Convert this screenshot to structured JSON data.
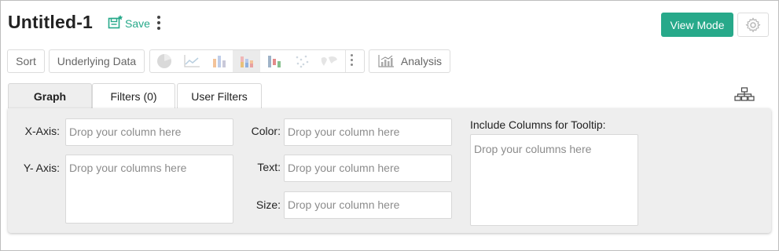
{
  "header": {
    "title": "Untitled-1",
    "save_label": "Save",
    "view_mode_label": "View Mode"
  },
  "toolbar": {
    "sort_label": "Sort",
    "underlying_data_label": "Underlying Data",
    "analysis_label": "Analysis",
    "chart_types": [
      "pie",
      "line",
      "bar",
      "stacked-bar",
      "waterfall",
      "scatter",
      "map"
    ],
    "active_chart": "stacked-bar"
  },
  "tabs": [
    {
      "label": "Graph",
      "active": true
    },
    {
      "label": "Filters (0)",
      "active": false
    },
    {
      "label": "User Filters",
      "active": false
    }
  ],
  "fields": {
    "x_axis": {
      "label": "X-Axis:",
      "placeholder": "Drop your column here"
    },
    "y_axis": {
      "label": "Y- Axis:",
      "placeholder": "Drop your columns here"
    },
    "color": {
      "label": "Color:",
      "placeholder": "Drop your column here"
    },
    "text": {
      "label": "Text:",
      "placeholder": "Drop your column here"
    },
    "size": {
      "label": "Size:",
      "placeholder": "Drop your column here"
    },
    "tooltip": {
      "label": "Include Columns for Tooltip:",
      "placeholder": "Drop your columns here"
    }
  },
  "colors": {
    "accent": "#27a98a",
    "panel": "#eeeeee",
    "border": "#d8d8d8"
  }
}
